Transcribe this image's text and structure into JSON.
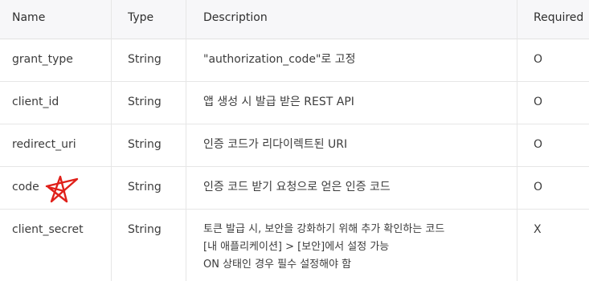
{
  "table": {
    "headers": {
      "name": "Name",
      "type": "Type",
      "description": "Description",
      "required": "Required"
    },
    "rows": [
      {
        "name": "grant_type",
        "type": "String",
        "description": "\"authorization_code\"로 고정",
        "required": "O"
      },
      {
        "name": "client_id",
        "type": "String",
        "description": "앱 생성 시 발급 받은 REST API",
        "required": "O"
      },
      {
        "name": "redirect_uri",
        "type": "String",
        "description": "인증 코드가 리다이렉트된 URI",
        "required": "O"
      },
      {
        "name": "code",
        "type": "String",
        "description": "인증 코드 받기 요청으로 얻은 인증 코드",
        "required": "O"
      },
      {
        "name": "client_secret",
        "type": "String",
        "description_lines": [
          "토큰 발급 시, 보안을 강화하기 위해 추가 확인하는 코드",
          "[내 애플리케이션] > [보안]에서 설정 가능",
          "ON 상태인 경우 필수 설정해야 함"
        ],
        "required": "X"
      }
    ]
  },
  "annotation": {
    "icon": "hand-drawn-star-icon",
    "color": "#e0201a"
  }
}
